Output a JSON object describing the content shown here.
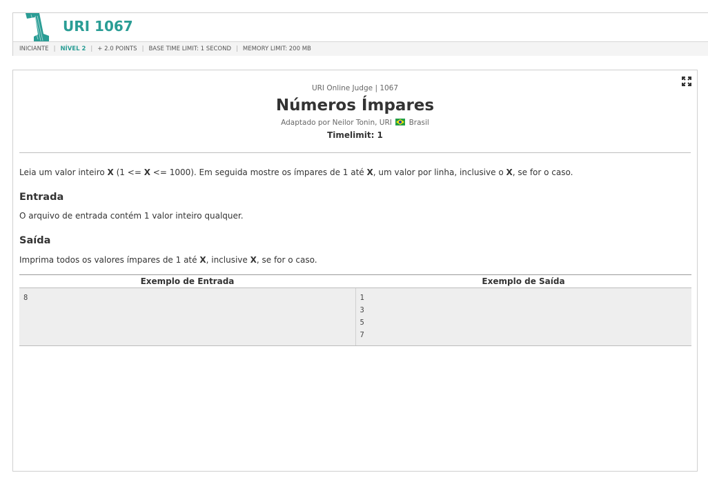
{
  "header": {
    "problem_code": "URI 1067",
    "category": "INICIANTE",
    "level": "NÍVEL 2",
    "points": "+ 2.0 POINTS",
    "base_time_limit": "BASE TIME LIMIT: 1 SECOND",
    "memory_limit": "MEMORY LIMIT: 200 MB"
  },
  "problem": {
    "judge": "URI Online Judge | 1067",
    "title": "Números Ímpares",
    "author_prefix": "Adaptado por Neilor Tonin, URI",
    "country": "Brasil",
    "timelimit": "Timelimit: 1",
    "description": [
      {
        "text": "Leia um valor inteiro ",
        "bold": false
      },
      {
        "text": "X",
        "bold": true
      },
      {
        "text": " (1 <= ",
        "bold": false
      },
      {
        "text": "X",
        "bold": true
      },
      {
        "text": " <= 1000). Em seguida mostre os ímpares de 1 até ",
        "bold": false
      },
      {
        "text": "X",
        "bold": true
      },
      {
        "text": ", um valor por linha, inclusive o ",
        "bold": false
      },
      {
        "text": "X",
        "bold": true
      },
      {
        "text": ", se for o caso.",
        "bold": false
      }
    ],
    "input_title": "Entrada",
    "input_text": "O arquivo de entrada contém 1 valor inteiro qualquer.",
    "output_title": "Saída",
    "output_text": [
      {
        "text": "Imprima todos os valores ímpares de 1 até ",
        "bold": false
      },
      {
        "text": "X",
        "bold": true
      },
      {
        "text": ", inclusive ",
        "bold": false
      },
      {
        "text": "X",
        "bold": true
      },
      {
        "text": ", se for o caso.",
        "bold": false
      }
    ],
    "sample_input_header": "Exemplo de Entrada",
    "sample_output_header": "Exemplo de Saída",
    "sample_input": [
      "8"
    ],
    "sample_output": [
      "1",
      "3",
      "5",
      "7"
    ]
  },
  "colors": {
    "accent": "#2a9d95",
    "sample_bg": "#eeeeee",
    "flag_green": "#229e45",
    "flag_yellow": "#f8e509",
    "flag_blue": "#2b49a3"
  },
  "icons": {
    "logo": "uri-logo-icon",
    "expand": "fullscreen-icon",
    "flag": "brazil-flag-icon"
  }
}
